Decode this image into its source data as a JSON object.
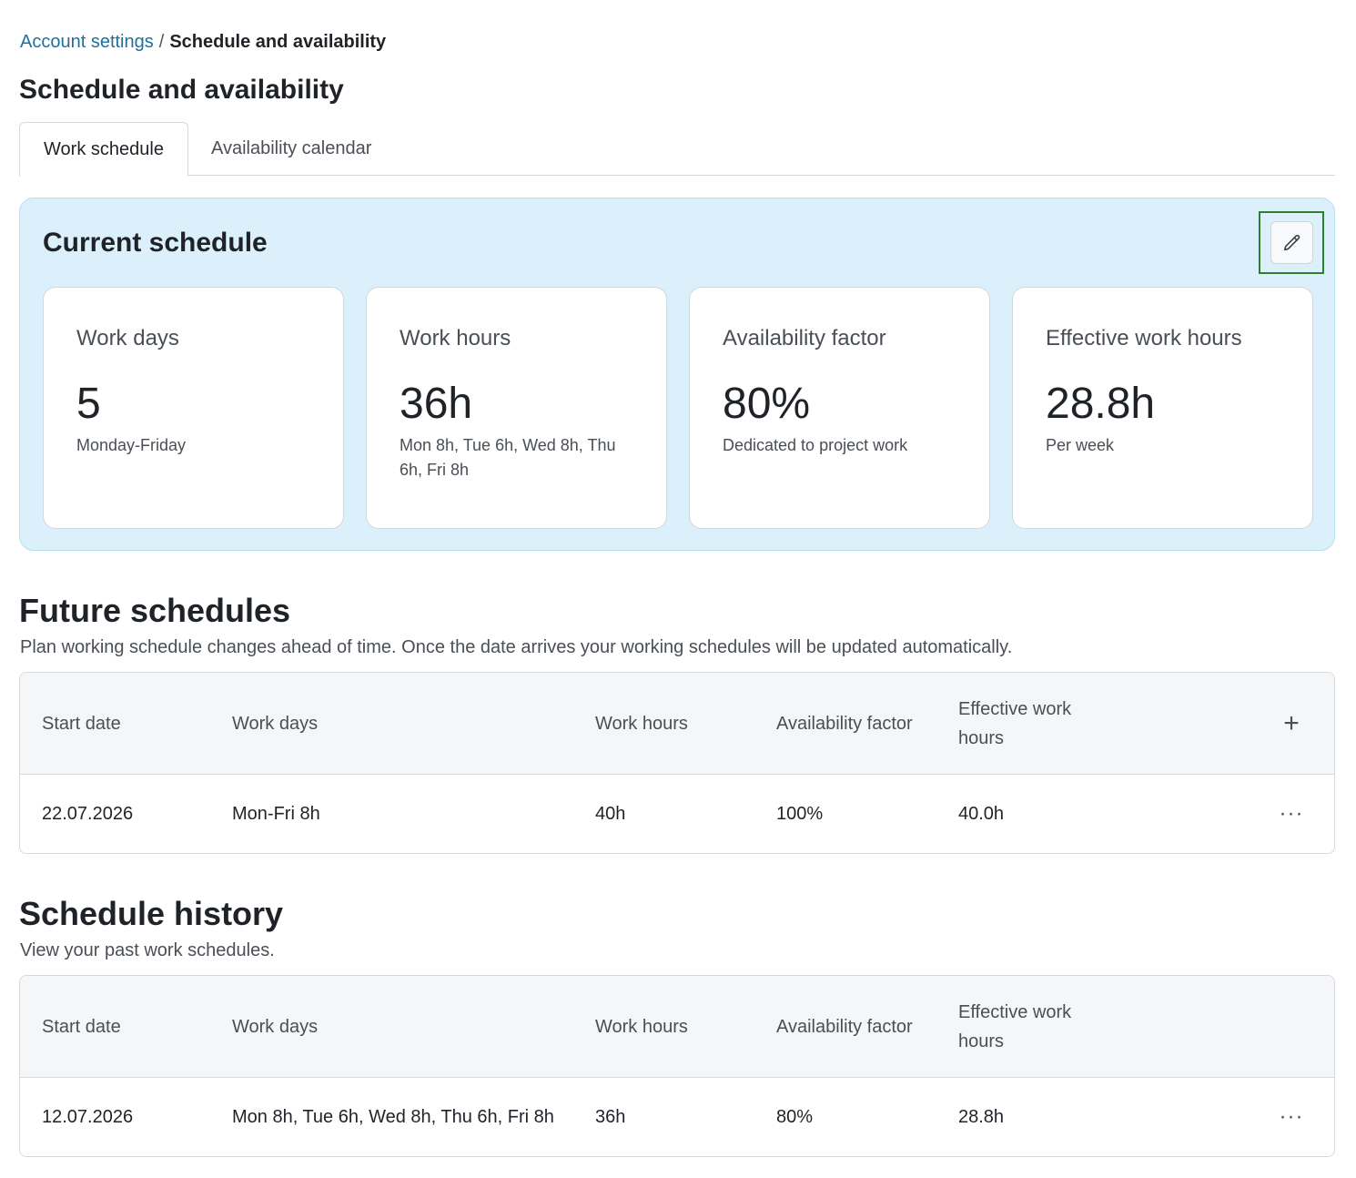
{
  "breadcrumb": {
    "parent": "Account settings",
    "separator": "/",
    "current": "Schedule and availability"
  },
  "page_title": "Schedule and availability",
  "tabs": [
    {
      "label": "Work schedule",
      "active": true
    },
    {
      "label": "Availability calendar",
      "active": false
    }
  ],
  "current_schedule": {
    "title": "Current schedule",
    "edit_icon": "pencil-icon",
    "cards": [
      {
        "label": "Work days",
        "value": "5",
        "sub": "Monday-Friday"
      },
      {
        "label": "Work hours",
        "value": "36h",
        "sub": "Mon 8h, Tue 6h, Wed 8h, Thu 6h, Fri 8h"
      },
      {
        "label": "Availability factor",
        "value": "80%",
        "sub": "Dedicated to project work"
      },
      {
        "label": "Effective work hours",
        "value": "28.8h",
        "sub": "Per week"
      }
    ]
  },
  "future": {
    "title": "Future schedules",
    "description": "Plan working schedule changes ahead of time. Once the date arrives your working schedules will be updated automatically.",
    "columns": [
      "Start date",
      "Work days",
      "Work hours",
      "Availability factor",
      "Effective work hours"
    ],
    "add_icon": "+",
    "rows": [
      {
        "start_date": "22.07.2026",
        "work_days": "Mon-Fri 8h",
        "work_hours": "40h",
        "availability": "100%",
        "effective": "40.0h",
        "menu": "···"
      }
    ]
  },
  "history": {
    "title": "Schedule history",
    "description": "View your past work schedules.",
    "columns": [
      "Start date",
      "Work days",
      "Work hours",
      "Availability factor",
      "Effective work hours"
    ],
    "rows": [
      {
        "start_date": "12.07.2026",
        "work_days": "Mon 8h, Tue 6h, Wed 8h, Thu 6h, Fri 8h",
        "work_hours": "36h",
        "availability": "80%",
        "effective": "28.8h",
        "menu": "···"
      }
    ]
  },
  "colors": {
    "accent_link": "#1f6f9f",
    "panel_bg": "#dbf0fb",
    "focus_outline": "#2e7d32"
  }
}
